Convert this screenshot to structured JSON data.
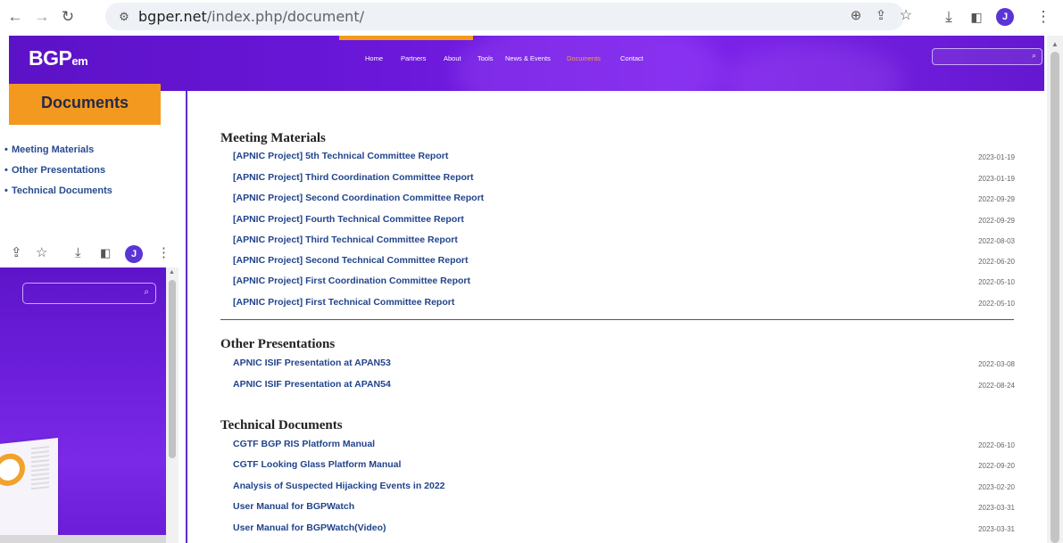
{
  "browser": {
    "url_host": "bgper.net",
    "url_path": "/index.php/document/",
    "profile_initial": "J"
  },
  "site": {
    "logo_main": "BGP",
    "logo_sub": "em",
    "nav": [
      "Home",
      "Partners",
      "About",
      "Tools",
      "News & Events",
      "Documents",
      "Contact"
    ],
    "active_nav": "Documents",
    "accent_color": "#f4991f",
    "header_color": "#6a17d9"
  },
  "sidebar": {
    "title": "Documents",
    "items": [
      "Meeting Materials",
      "Other Presentations",
      "Technical Documents"
    ]
  },
  "sections": [
    {
      "title": "Meeting Materials",
      "items": [
        {
          "label": "[APNIC Project] 5th Technical Committee Report",
          "date": "2023-01-19"
        },
        {
          "label": "[APNIC Project] Third Coordination Committee Report",
          "date": "2023-01-19"
        },
        {
          "label": "[APNIC Project] Second Coordination Committee Report",
          "date": "2022-09-29"
        },
        {
          "label": "[APNIC Project] Fourth Technical Committee Report",
          "date": "2022-09-29"
        },
        {
          "label": "[APNIC Project] Third Technical Committee Report",
          "date": "2022-08-03"
        },
        {
          "label": "[APNIC Project] Second Technical Committee Report",
          "date": "2022-06-20"
        },
        {
          "label": "[APNIC Project] First Coordination Committee Report",
          "date": "2022-05-10"
        },
        {
          "label": "[APNIC Project] First Technical Committee Report",
          "date": "2022-05-10"
        }
      ]
    },
    {
      "title": "Other Presentations",
      "items": [
        {
          "label": "APNIC ISIF Presentation at APAN53",
          "date": "2022-03-08"
        },
        {
          "label": "APNIC ISIF Presentation at APAN54",
          "date": "2022-08-24"
        }
      ]
    },
    {
      "title": "Technical Documents",
      "items": [
        {
          "label": "CGTF BGP RIS Platform Manual",
          "date": "2022-06-10"
        },
        {
          "label": "CGTF Looking Glass Platform Manual",
          "date": "2022-09-20"
        },
        {
          "label": "Analysis of Suspected Hijacking Events in 2022",
          "date": "2023-02-20"
        },
        {
          "label": "User Manual for BGPWatch",
          "date": "2023-03-31"
        },
        {
          "label": "User Manual for BGPWatch(Video)",
          "date": "2023-03-31"
        }
      ]
    }
  ],
  "icons": {
    "back": "arrow-left-icon",
    "forward": "arrow-right-icon",
    "reload": "reload-icon",
    "site_info": "site-info-icon",
    "zoom": "zoom-icon",
    "share": "share-icon",
    "bookmark": "star-icon",
    "download": "download-icon",
    "side_panel": "side-panel-icon",
    "menu": "kebab-menu-icon",
    "search": "search-icon"
  }
}
